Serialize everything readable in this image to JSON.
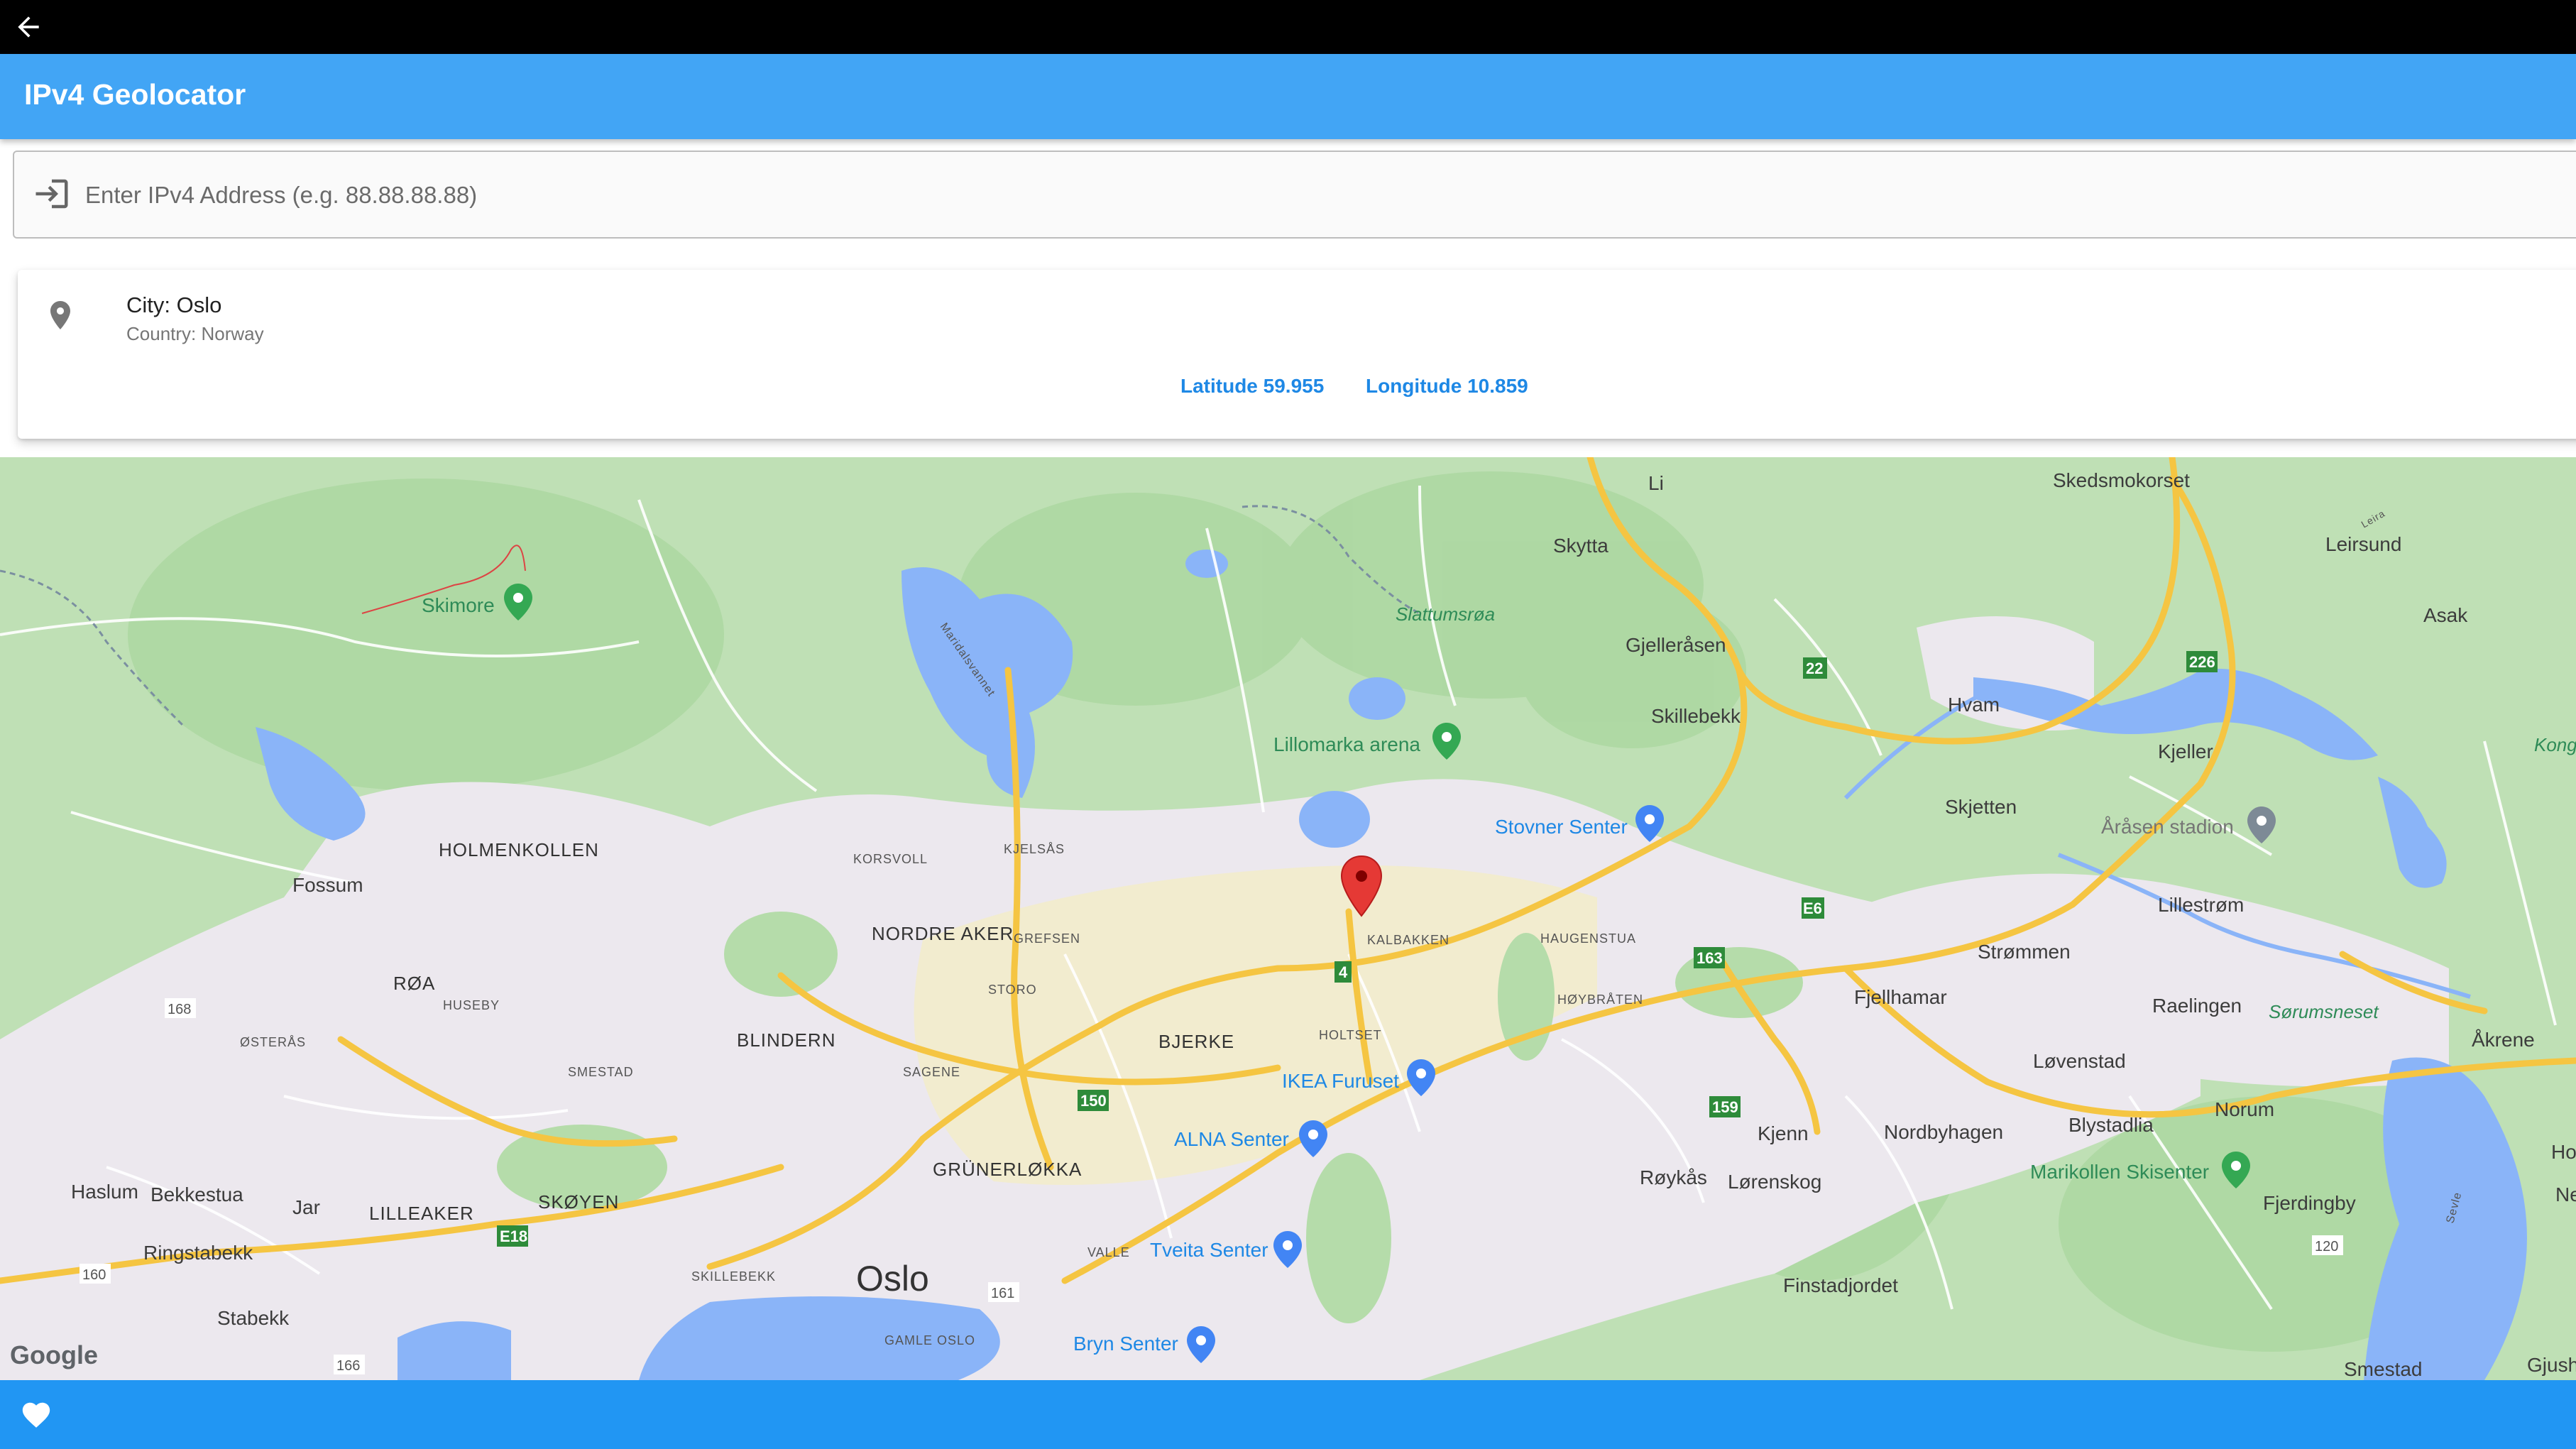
{
  "app": {
    "title": "IPv4 Geolocator"
  },
  "icons": {
    "back": "arrow-back-icon",
    "input": "login-icon",
    "location": "location-pin-icon",
    "favorite": "heart-icon",
    "marker": "red-map-marker-icon"
  },
  "colors": {
    "appbar": "#42a5f5",
    "bottombar": "#2196f3",
    "link": "#1e88e5",
    "marker": "#e53935"
  },
  "search": {
    "placeholder": "Enter IPv4 Address (e.g. 88.88.88.88)",
    "value": ""
  },
  "result": {
    "city": "City: Oslo",
    "country": "Country: Norway",
    "latitude_label": "Latitude 59.955",
    "longitude_label": "Longitude 10.859"
  },
  "map": {
    "attribution": "Google",
    "labels": {
      "oslo": "Oslo",
      "li": "Li",
      "skedsmokorset": "Skedsmokorset",
      "skytta": "Skytta",
      "leirsund": "Leirsund",
      "asak": "Asak",
      "gjellerasen": "Gjelleråsen",
      "slattumsroa": "Slattumsrøa",
      "skillebekk": "Skillebekk",
      "hvam": "Hvam",
      "kjeller": "Kjeller",
      "kong": "Kong",
      "skimore": "Skimore",
      "lillomarka": "Lillomarka arena",
      "stovner": "Stovner Senter",
      "skjetten": "Skjetten",
      "arasen": "Åråsen stadion",
      "holmenkollen": "HOLMENKOLLEN",
      "fossum": "Fossum",
      "korsvoll": "KORSVOLL",
      "kjelsas": "KJELSÅS",
      "nordre_aker": "NORDRE AKER",
      "grefsen": "GREFSEN",
      "kalbakken": "KALBAKKEN",
      "haugenstua": "HAUGENSTUA",
      "lillestrom": "Lillestrøm",
      "strommen": "Strømmen",
      "fjellhamar": "Fjellhamar",
      "raelingen": "Raelingen",
      "sorumsneset": "Sørumsneset",
      "akrene": "Åkrene",
      "roa": "RØA",
      "huseby": "HUSEBY",
      "storo": "STORO",
      "hoybraten": "HØYBRÅTEN",
      "osteras": "ØSTERÅS",
      "blindern": "BLINDERN",
      "bjerke": "BJERKE",
      "holtset": "HOLTSET",
      "smestad": "SMESTAD",
      "sagene": "SAGENE",
      "ikea": "IKEA Furuset",
      "lovenstad": "Løvenstad",
      "alna": "ALNA Senter",
      "kjenn": "Kjenn",
      "nordbyhagen": "Nordbyhagen",
      "blystadlia": "Blystadlia",
      "norum": "Norum",
      "haslum": "Haslum",
      "bekkestua": "Bekkestua",
      "jar": "Jar",
      "lilleaker": "LILLEAKER",
      "skoyen": "SKØYEN",
      "grunerlokka": "GRÜNERLØKKA",
      "roykas": "Røykås",
      "lorenskog": "Lørenskog",
      "marikollen": "Marikollen Skisenter",
      "fjerdingby": "Fjerdingby",
      "ringstabekk": "Ringstabekk",
      "skillebekk2": "SKILLEBEKK",
      "valle": "VALLE",
      "tveita": "Tveita Senter",
      "finstadjordet": "Finstadjordet",
      "stabekk": "Stabekk",
      "gamle_oslo": "GAMLE OSLO",
      "bryn": "Bryn Senter",
      "smestad2": "Smestad",
      "gjush": "Gjush",
      "ho": "Ho",
      "ne": "Ne",
      "maridalsvannet": "Maridalsvannet",
      "sevle": "Sevle",
      "leira": "Leira"
    },
    "shields": {
      "r22": "22",
      "r226": "226",
      "e6": "E6",
      "r163": "163",
      "r4": "4",
      "r150": "150",
      "r159": "159",
      "r168": "168",
      "e18": "E18",
      "r160": "160",
      "r161": "161",
      "r120": "120",
      "r166": "166"
    }
  }
}
